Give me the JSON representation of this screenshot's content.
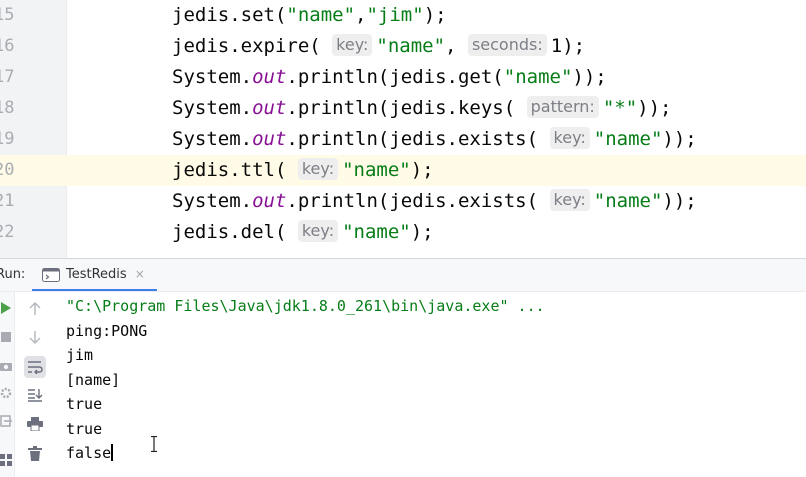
{
  "editor": {
    "lines": [
      {
        "num": "15",
        "text": "jedis.set(\"name\",\"jim\");"
      },
      {
        "num": "16",
        "text": "jedis.expire( key: \"name\", seconds: 1);"
      },
      {
        "num": "17",
        "text": "System.out.println(jedis.get(\"name\"));"
      },
      {
        "num": "18",
        "text": "System.out.println(jedis.keys( pattern: \"*\"));"
      },
      {
        "num": "19",
        "text": "System.out.println(jedis.exists( key: \"name\"));"
      },
      {
        "num": "20",
        "text": "jedis.ttl( key: \"name\");"
      },
      {
        "num": "21",
        "text": "System.out.println(jedis.exists( key: \"name\"));"
      },
      {
        "num": "22",
        "text": "jedis.del( key: \"name\");"
      }
    ],
    "tokens": {
      "jedis_set": "jedis.set(",
      "jedis_expire": "jedis.expire(",
      "jedis_ttl": "jedis.ttl(",
      "jedis_del": "jedis.del(",
      "system": "System.",
      "out": "out",
      "println_get": ".println(jedis.get(",
      "println_keys": ".println(jedis.keys(",
      "println_exists": ".println(jedis.exists(",
      "str_name": "\"name\"",
      "str_jim": "\"jim\"",
      "str_star": "\"*\"",
      "comma": ",",
      "num_1": "1",
      "end_semicolon": ");",
      "end_double": "));",
      "hint_key": "key:",
      "hint_seconds": "seconds:",
      "hint_pattern": "pattern:"
    },
    "current_line": "20"
  },
  "run_window": {
    "label": "Run:",
    "tab": "TestRedis",
    "close_glyph": "×",
    "output": [
      "\"C:\\Program Files\\Java\\jdk1.8.0_261\\bin\\java.exe\" ...",
      "ping:PONG",
      "jim",
      "[name]",
      "true",
      "true",
      "false"
    ]
  },
  "icons": [
    "run-icon",
    "stop-icon",
    "camera-icon",
    "settings-icon",
    "exit-icon",
    "layout-icon",
    "up-arrow-icon",
    "down-arrow-icon",
    "soft-wrap-icon",
    "scroll-to-end-icon",
    "print-icon",
    "trash-icon"
  ],
  "colors": {
    "string": "#067d17",
    "field": "#871094",
    "accent": "#3d7ee8",
    "current_line": "#fffbe6"
  }
}
